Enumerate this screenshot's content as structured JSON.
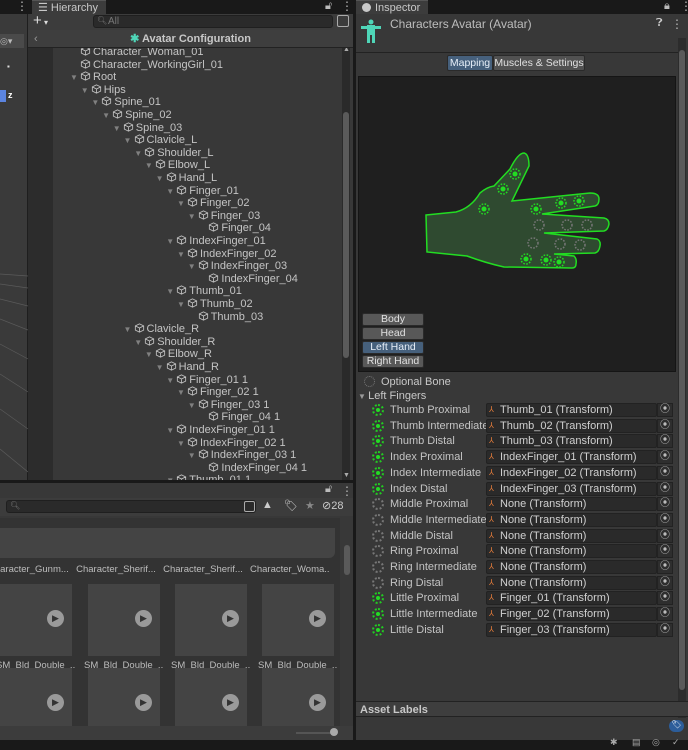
{
  "hierarchy": {
    "tab": "Hierarchy",
    "search_placeholder": "All",
    "add_label": "+",
    "avatar_config": "Avatar Configuration",
    "rows": [
      {
        "name": "Character_Woman_01",
        "level": 0,
        "arrow": false
      },
      {
        "name": "Character_WorkingGirl_01",
        "level": 0,
        "arrow": false
      },
      {
        "name": "Root",
        "level": 0,
        "arrow": true
      },
      {
        "name": "Hips",
        "level": 1,
        "arrow": true
      },
      {
        "name": "Spine_01",
        "level": 2,
        "arrow": true
      },
      {
        "name": "Spine_02",
        "level": 3,
        "arrow": true
      },
      {
        "name": "Spine_03",
        "level": 4,
        "arrow": true
      },
      {
        "name": "Clavicle_L",
        "level": 5,
        "arrow": true
      },
      {
        "name": "Shoulder_L",
        "level": 6,
        "arrow": true
      },
      {
        "name": "Elbow_L",
        "level": 7,
        "arrow": true
      },
      {
        "name": "Hand_L",
        "level": 8,
        "arrow": true
      },
      {
        "name": "Finger_01",
        "level": 9,
        "arrow": true
      },
      {
        "name": "Finger_02",
        "level": 10,
        "arrow": true
      },
      {
        "name": "Finger_03",
        "level": 11,
        "arrow": true
      },
      {
        "name": "Finger_04",
        "level": 12,
        "arrow": false
      },
      {
        "name": "IndexFinger_01",
        "level": 9,
        "arrow": true
      },
      {
        "name": "IndexFinger_02",
        "level": 10,
        "arrow": true
      },
      {
        "name": "IndexFinger_03",
        "level": 11,
        "arrow": true
      },
      {
        "name": "IndexFinger_04",
        "level": 12,
        "arrow": false
      },
      {
        "name": "Thumb_01",
        "level": 9,
        "arrow": true
      },
      {
        "name": "Thumb_02",
        "level": 10,
        "arrow": true
      },
      {
        "name": "Thumb_03",
        "level": 11,
        "arrow": false
      },
      {
        "name": "Clavicle_R",
        "level": 5,
        "arrow": true
      },
      {
        "name": "Shoulder_R",
        "level": 6,
        "arrow": true
      },
      {
        "name": "Elbow_R",
        "level": 7,
        "arrow": true
      },
      {
        "name": "Hand_R",
        "level": 8,
        "arrow": true
      },
      {
        "name": "Finger_01 1",
        "level": 9,
        "arrow": true
      },
      {
        "name": "Finger_02 1",
        "level": 10,
        "arrow": true
      },
      {
        "name": "Finger_03 1",
        "level": 11,
        "arrow": true
      },
      {
        "name": "Finger_04 1",
        "level": 12,
        "arrow": false
      },
      {
        "name": "IndexFinger_01 1",
        "level": 9,
        "arrow": true
      },
      {
        "name": "IndexFinger_02 1",
        "level": 10,
        "arrow": true
      },
      {
        "name": "IndexFinger_03 1",
        "level": 11,
        "arrow": true
      },
      {
        "name": "IndexFinger_04 1",
        "level": 12,
        "arrow": false
      },
      {
        "name": "Thumb_01 1",
        "level": 9,
        "arrow": true
      }
    ]
  },
  "project": {
    "hidden_count": "28",
    "assets_row1": [
      "Character_Gunm...",
      "Character_Sherif...",
      "Character_Sherif...",
      "Character_Woma..."
    ],
    "assets_row2": [
      "SM_Bld_Double_...",
      "SM_Bld_Double_...",
      "SM_Bld_Double_...",
      "SM_Bld_Double_..."
    ],
    "play_glyph": "▶"
  },
  "inspector": {
    "tab": "Inspector",
    "title": "Characters Avatar (Avatar)",
    "tabs": [
      "Mapping",
      "Muscles & Settings"
    ],
    "active_tab": 0,
    "part_buttons": [
      "Body",
      "Head",
      "Left Hand",
      "Right Hand"
    ],
    "active_part": 2,
    "optional_bone": "Optional Bone",
    "section": "Left Fingers",
    "bones": [
      {
        "label": "Thumb Proximal",
        "value": "Thumb_01 (Transform)",
        "mapped": true
      },
      {
        "label": "Thumb Intermediate",
        "value": "Thumb_02 (Transform)",
        "mapped": true
      },
      {
        "label": "Thumb Distal",
        "value": "Thumb_03 (Transform)",
        "mapped": true
      },
      {
        "label": "Index Proximal",
        "value": "IndexFinger_01 (Transform)",
        "mapped": true
      },
      {
        "label": "Index Intermediate",
        "value": "IndexFinger_02 (Transform)",
        "mapped": true
      },
      {
        "label": "Index Distal",
        "value": "IndexFinger_03 (Transform)",
        "mapped": true
      },
      {
        "label": "Middle Proximal",
        "value": "None (Transform)",
        "mapped": false
      },
      {
        "label": "Middle Intermediate",
        "value": "None (Transform)",
        "mapped": false
      },
      {
        "label": "Middle Distal",
        "value": "None (Transform)",
        "mapped": false
      },
      {
        "label": "Ring Proximal",
        "value": "None (Transform)",
        "mapped": false
      },
      {
        "label": "Ring Intermediate",
        "value": "None (Transform)",
        "mapped": false
      },
      {
        "label": "Ring Distal",
        "value": "None (Transform)",
        "mapped": false
      },
      {
        "label": "Little Proximal",
        "value": "Finger_01 (Transform)",
        "mapped": true
      },
      {
        "label": "Little Intermediate",
        "value": "Finger_02 (Transform)",
        "mapped": true
      },
      {
        "label": "Little Distal",
        "value": "Finger_03 (Transform)",
        "mapped": true
      }
    ],
    "asset_labels": "Asset Labels"
  },
  "colors": {
    "mapped": "#22dd22",
    "unmapped": "#777777",
    "accent": "#46607c",
    "avatar": "#4fd6b8"
  }
}
